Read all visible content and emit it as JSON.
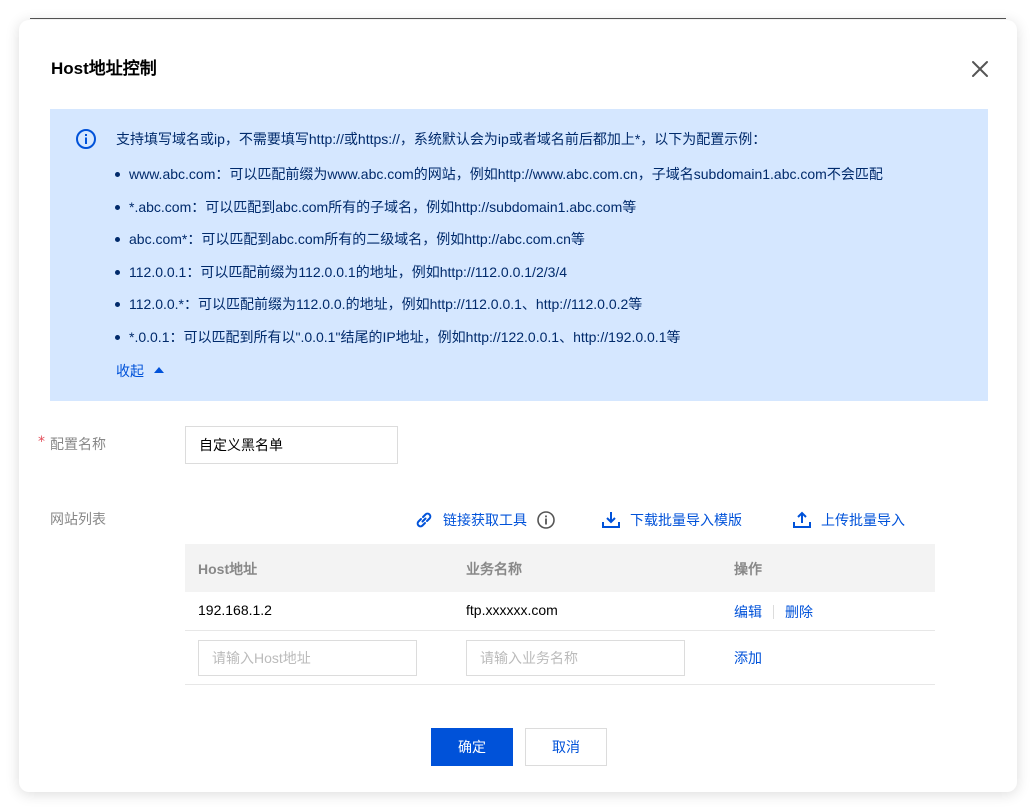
{
  "dialog": {
    "title": "Host地址控制"
  },
  "info": {
    "intro": "支持填写域名或ip，不需要填写http://或https://，系统默认会为ip或者域名前后都加上*，以下为配置示例：",
    "examples": [
      "www.abc.com：可以匹配前缀为www.abc.com的网站，例如http://www.abc.com.cn，子域名subdomain1.abc.com不会匹配",
      "*.abc.com：可以匹配到abc.com所有的子域名，例如http://subdomain1.abc.com等",
      "abc.com*：可以匹配到abc.com所有的二级域名，例如http://abc.com.cn等",
      "112.0.0.1：可以匹配前缀为112.0.0.1的地址，例如http://112.0.0.1/2/3/4",
      "112.0.0.*：可以匹配前缀为112.0.0.的地址，例如http://112.0.0.1、http://112.0.0.2等",
      "*.0.0.1：可以匹配到所有以\".0.0.1\"结尾的IP地址，例如http://122.0.0.1、http://192.0.0.1等"
    ],
    "collapse_label": "收起"
  },
  "form": {
    "required_mark": "*",
    "name_label": "配置名称",
    "name_value": "自定义黑名单",
    "list_label": "网站列表"
  },
  "tools": {
    "link_tool": "链接获取工具",
    "download_template": "下载批量导入模版",
    "upload_import": "上传批量导入"
  },
  "table": {
    "headers": [
      "Host地址",
      "业务名称",
      "操作"
    ],
    "rows": [
      {
        "host": "192.168.1.2",
        "business": "ftp.xxxxxx.com",
        "edit": "编辑",
        "delete": "删除"
      }
    ],
    "host_placeholder": "请输入Host地址",
    "business_placeholder": "请输入业务名称",
    "add_label": "添加"
  },
  "footer": {
    "confirm": "确定",
    "cancel": "取消"
  },
  "colors": {
    "primary": "#0052d9",
    "info_bg": "#d5e7ff",
    "required": "#e34d59"
  }
}
